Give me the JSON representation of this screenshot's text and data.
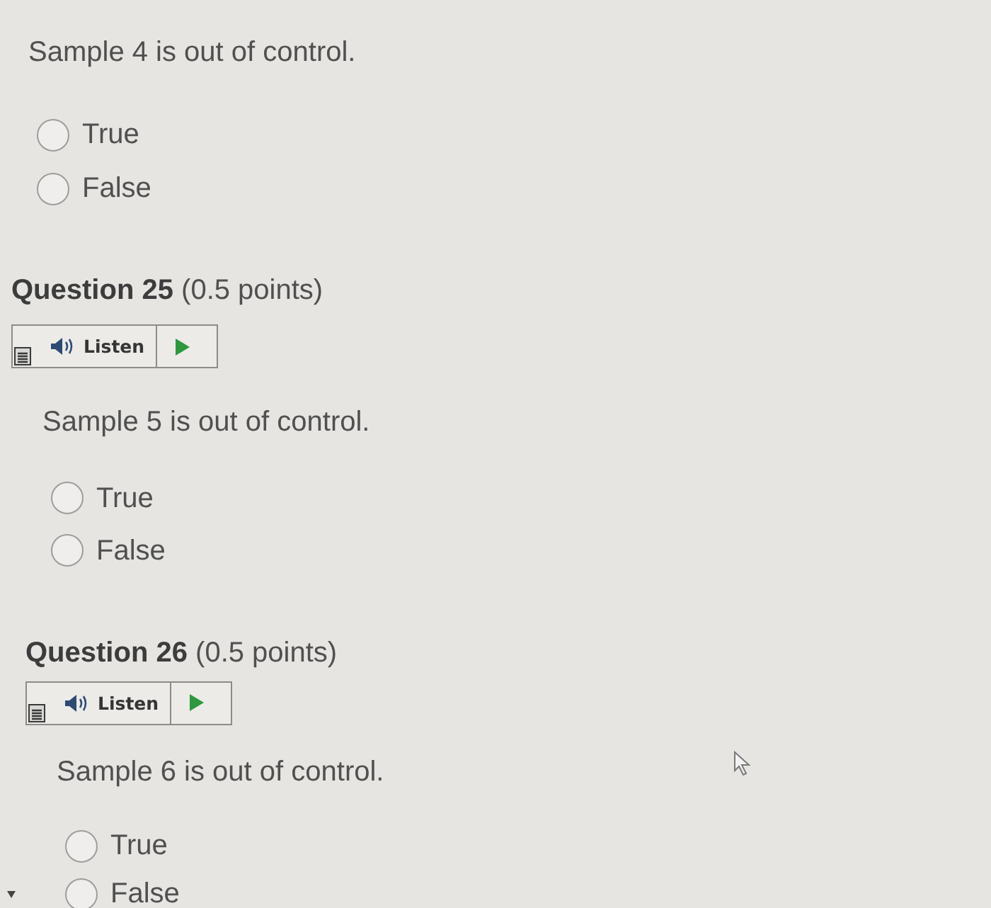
{
  "questions": [
    {
      "prompt": "Sample 4 is out of control.",
      "options": [
        {
          "label": "True",
          "selected": false
        },
        {
          "label": "False",
          "selected": false
        }
      ]
    },
    {
      "heading": "**Question 25** (0.5 points)",
      "listen": {
        "label": "Listen"
      },
      "prompt": "Sample 5 is out of control.",
      "options": [
        {
          "label": "True",
          "selected": false
        },
        {
          "label": "False",
          "selected": false
        }
      ]
    },
    {
      "heading": "**Question 26** (0.5 points)",
      "listen": {
        "label": "Listen"
      },
      "prompt": "Sample 6 is out of control.",
      "options": [
        {
          "label": "True",
          "selected": false
        },
        {
          "label": "False",
          "selected": false
        }
      ]
    }
  ]
}
